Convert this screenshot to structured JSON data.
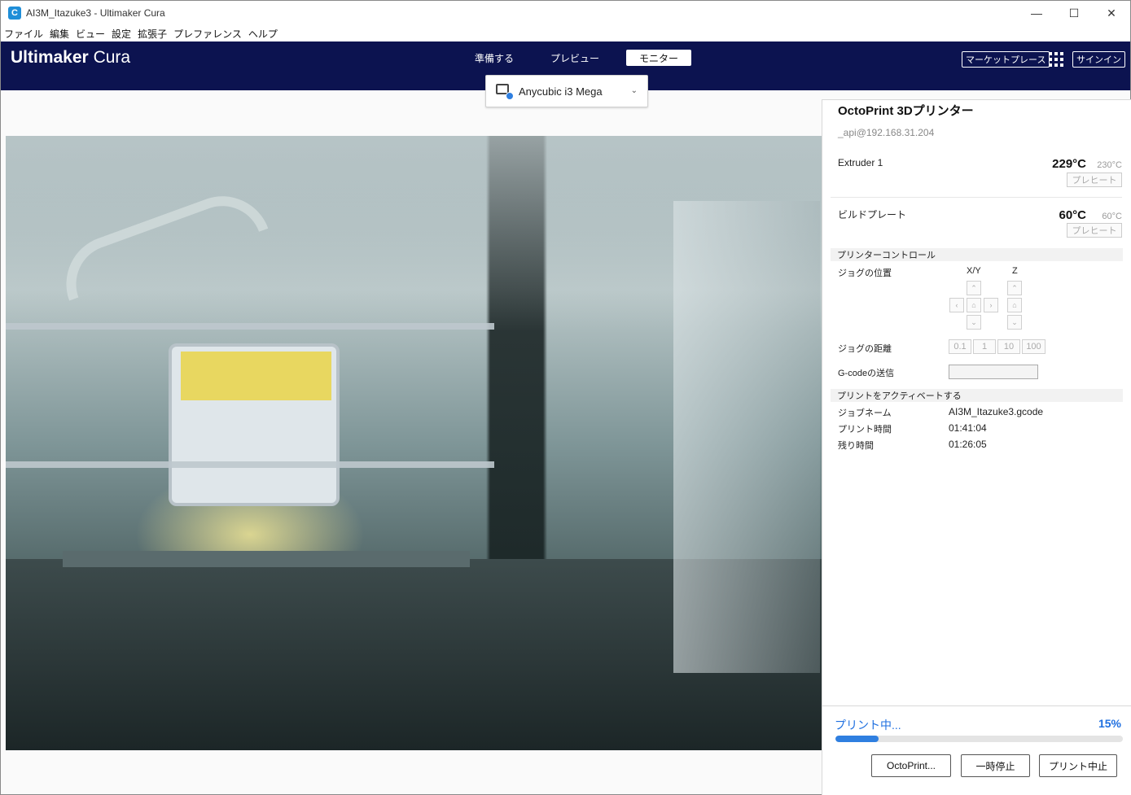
{
  "window": {
    "title": "AI3M_Itazuke3 - Ultimaker Cura",
    "app_icon_letter": "C",
    "minimize": "—",
    "maximize": "☐",
    "close": "✕"
  },
  "menu": [
    "ファイル",
    "編集",
    "ビュー",
    "設定",
    "拡張子",
    "プレファレンス",
    "ヘルプ"
  ],
  "header": {
    "logo_bold": "Ultimaker",
    "logo_light": "Cura",
    "stages": [
      "準備する",
      "プレビュー",
      "モニター"
    ],
    "active_stage": "モニター",
    "marketplace": "マーケットプレース",
    "signin": "サインイン"
  },
  "printer_selector": {
    "name": "Anycubic i3 Mega"
  },
  "monitor": {
    "title": "OctoPrint 3Dプリンター",
    "address": "_api@192.168.31.204",
    "extruder": {
      "label": "Extruder 1",
      "temp": "229°C",
      "target": "230°C",
      "preheat": "プレヒート"
    },
    "bed": {
      "label": "ビルドプレート",
      "temp": "60°C",
      "target": "60°C",
      "preheat": "プレヒート"
    },
    "control_header": "プリンターコントロール",
    "jog_position": "ジョグの位置",
    "xy_label": "X/Y",
    "z_label": "Z",
    "jog_distance": "ジョグの距離",
    "distances": [
      "0.1",
      "1",
      "10",
      "100"
    ],
    "gcode_label": "G-codeの送信",
    "active_header": "プリントをアクティベートする",
    "job_name_label": "ジョブネーム",
    "job_name": "AI3M_Itazuke3.gcode",
    "print_time_label": "プリント時間",
    "print_time": "01:41:04",
    "remaining_label": "残り時間",
    "remaining": "01:26:05"
  },
  "status": {
    "label": "プリント中...",
    "percent_text": "15%",
    "progress": 0.15,
    "buttons": [
      "OctoPrint...",
      "一時停止",
      "プリント中止"
    ]
  },
  "colors": {
    "header_bg": "#0c1350",
    "accent": "#1e6fe0"
  },
  "icons": {
    "printer": "printer-connected-icon",
    "chevron": "chevron-down-icon",
    "apps": "grid-icon"
  }
}
